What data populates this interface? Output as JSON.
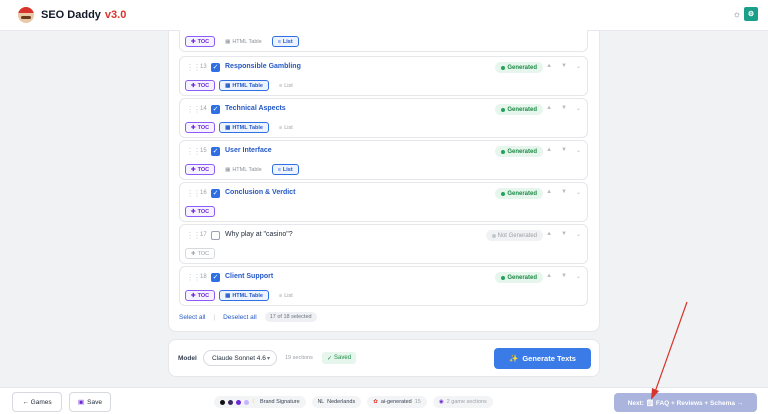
{
  "header": {
    "app_title": "SEO Daddy",
    "version": "v3.0",
    "lang_badge": "⚙"
  },
  "sections": [
    {
      "number": "",
      "title": "",
      "checked": true,
      "status": "",
      "tags": {
        "toc": "TOC",
        "html": "HTML Table",
        "list": "List"
      },
      "html_active": false,
      "list_active": true,
      "partial": true
    },
    {
      "number": "13",
      "title": "Responsible Gambling",
      "checked": true,
      "status": "Generated",
      "tags": {
        "toc": "TOC",
        "html": "HTML Table",
        "list": "List"
      },
      "html_active": true,
      "list_active": false
    },
    {
      "number": "14",
      "title": "Technical Aspects",
      "checked": true,
      "status": "Generated",
      "tags": {
        "toc": "TOC",
        "html": "HTML Table",
        "list": "List"
      },
      "html_active": true,
      "list_active": false
    },
    {
      "number": "15",
      "title": "User Interface",
      "checked": true,
      "status": "Generated",
      "tags": {
        "toc": "TOC",
        "html": "HTML Table",
        "list": "List"
      },
      "html_active": false,
      "list_active": true
    },
    {
      "number": "16",
      "title": "Conclusion & Verdict",
      "checked": true,
      "status": "Generated",
      "tags": {
        "toc": "TOC"
      }
    },
    {
      "number": "17",
      "title": "Why play at \"casino\"?",
      "checked": false,
      "status": "Not Generated",
      "tags": {
        "toc": "TOC"
      }
    },
    {
      "number": "18",
      "title": "Client Support",
      "checked": true,
      "status": "Generated",
      "tags": {
        "toc": "TOC",
        "html": "HTML Table",
        "list": "List"
      },
      "html_active": true,
      "list_active": false
    }
  ],
  "selection": {
    "select_all": "Select all",
    "deselect_all": "Deselect all",
    "count": "17 of 18 selected"
  },
  "model_bar": {
    "label": "Model",
    "selected_model": "Claude Sonnet 4.6",
    "sections": "19 sections",
    "saved": "Saved",
    "generate": "Generate Texts"
  },
  "footer": {
    "back": "← Games",
    "save": "Save",
    "brand_signature": "Brand Signature",
    "language": "Nederlands",
    "ai_generated": "ai-generated",
    "ai_count": "15",
    "game_sections": "2 game sections",
    "next": "Next: 🗒 FAQ + Reviews + Schema →"
  },
  "colors": {
    "accent": "#2f6fe4",
    "success": "#1c8a46",
    "brand_red": "#d9342b",
    "next_disabled": "#aab4dc",
    "swatches": [
      "#111111",
      "#3a2a63",
      "#6d28d9",
      "#c4b5fd",
      "#f2c94c"
    ]
  }
}
